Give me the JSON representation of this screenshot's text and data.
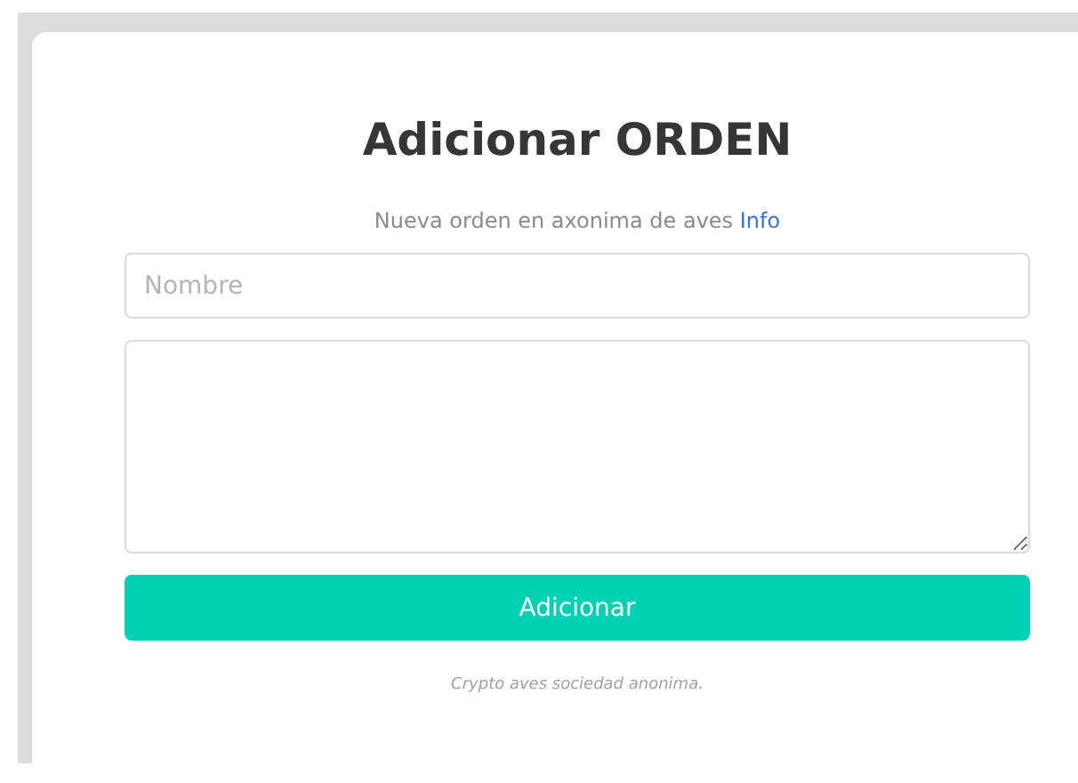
{
  "title": "Adicionar ORDEN",
  "subtitle": {
    "text": "Nueva orden en axonima de aves",
    "link": "Info"
  },
  "name_field": {
    "placeholder": "Nombre"
  },
  "submit_button": "Adicionar",
  "footer": "Crypto aves sociedad anonima."
}
